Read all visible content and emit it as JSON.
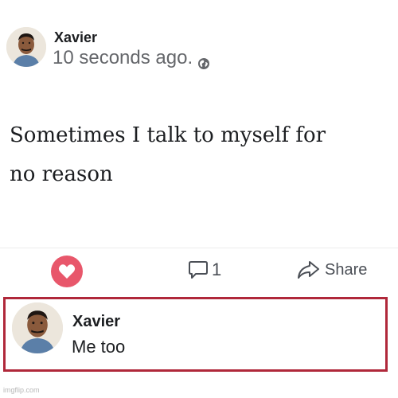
{
  "post": {
    "author": "Xavier",
    "timestamp": "10 seconds ago.",
    "privacy_icon": "globe-icon",
    "text_lines": [
      "Sometimes I talk to myself for",
      "no reason"
    ]
  },
  "actions": {
    "like_icon": "heart-icon",
    "comment_icon": "comment-bubble-icon",
    "comment_count": "1",
    "share_icon": "share-arrow-icon",
    "share_label": "Share"
  },
  "comment": {
    "author": "Xavier",
    "text": "Me too",
    "highlight_color": "#b0283a"
  },
  "colors": {
    "like_red": "#e8576b",
    "secondary_text": "#65676b"
  },
  "watermark": "imgflip.com"
}
